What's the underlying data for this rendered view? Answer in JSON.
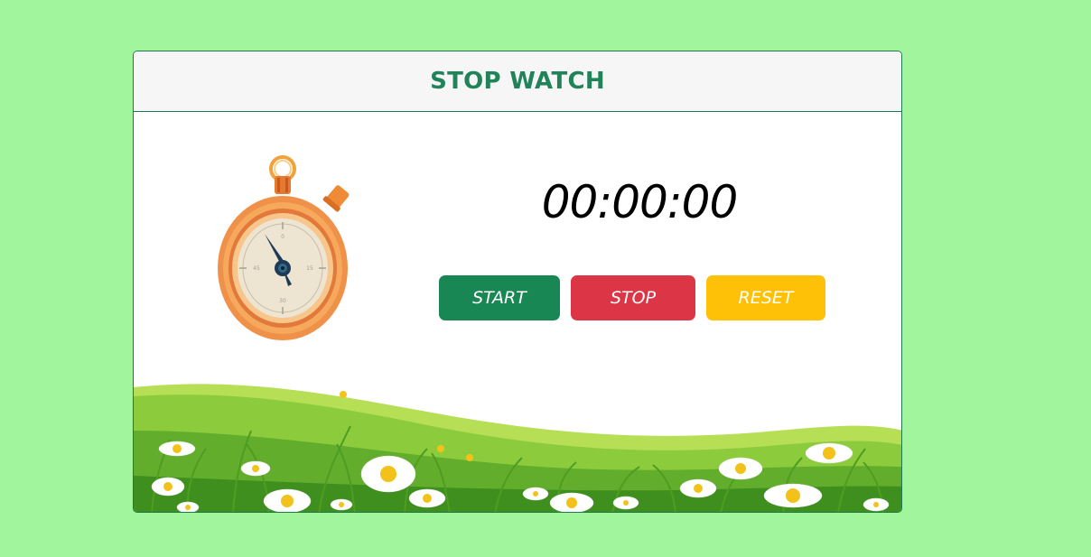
{
  "header": {
    "title": "STOP WATCH"
  },
  "timer": {
    "display": "00:00:00"
  },
  "controls": {
    "start_label": "START",
    "stop_label": "STOP",
    "reset_label": "RESET"
  },
  "colors": {
    "page_background": "#a1f59d",
    "title": "#20835a",
    "start": "#198754",
    "stop": "#dc3545",
    "reset": "#ffc107"
  },
  "icons": [
    "stopwatch-icon",
    "meadow-illustration"
  ]
}
